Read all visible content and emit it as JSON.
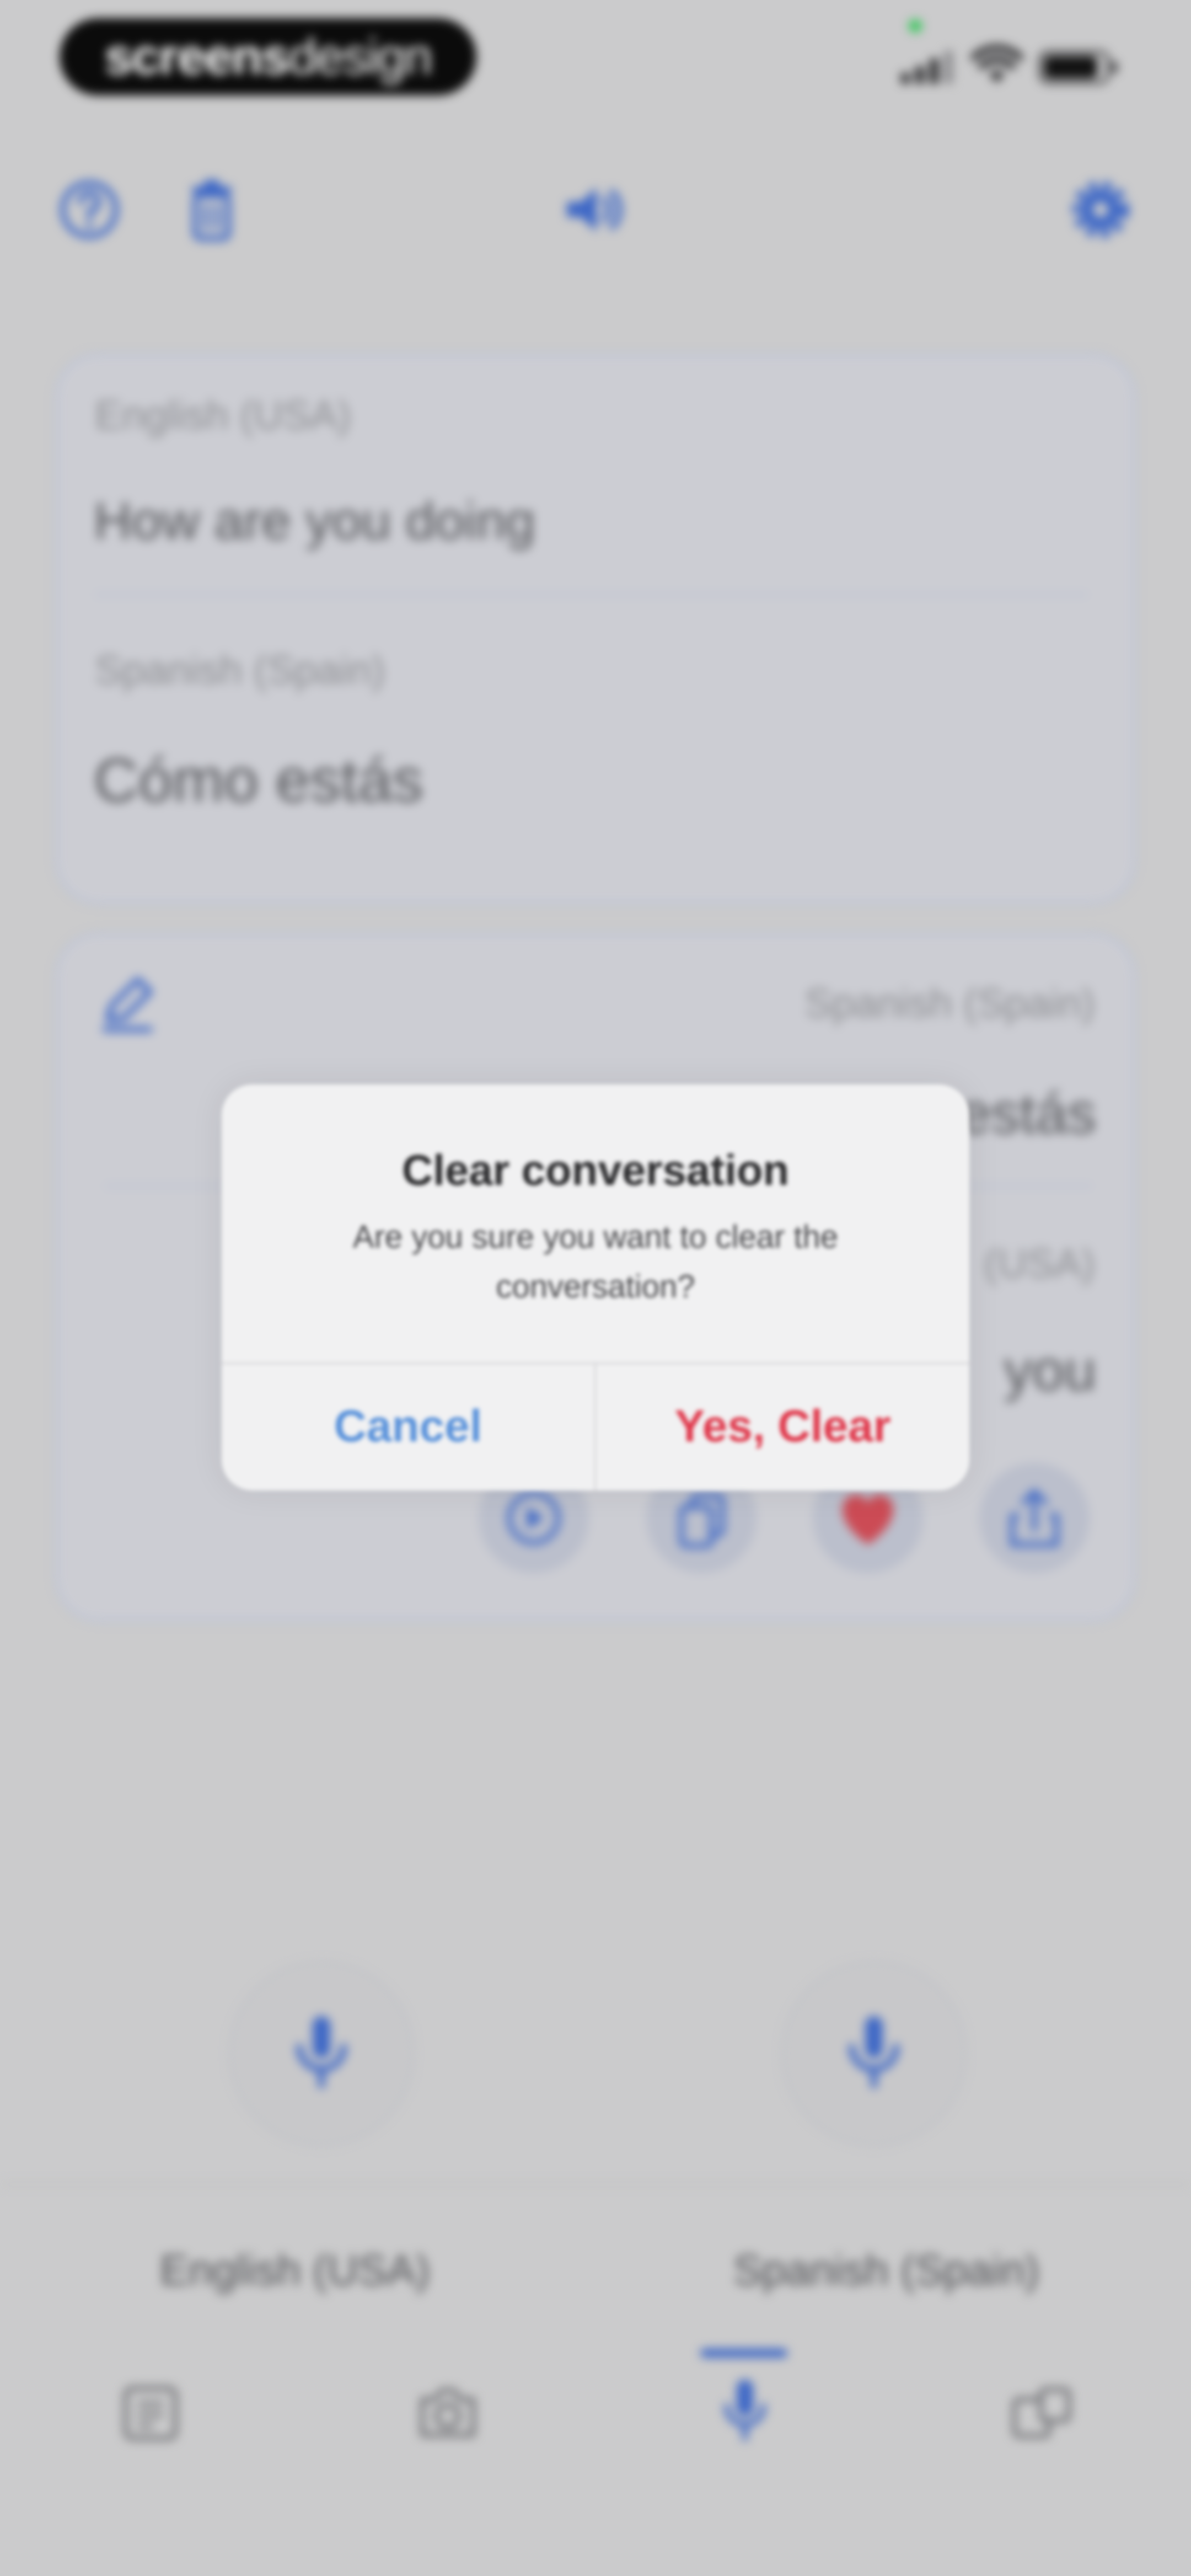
{
  "status_bar": {
    "brand_bold": "screens",
    "brand_light": "design"
  },
  "toolbar": {
    "help_icon": "question-circle-icon",
    "delete_icon": "trash-icon",
    "speaker_icon": "speaker-icon",
    "settings_icon": "gear-icon"
  },
  "card1": {
    "source_lang": "English (USA)",
    "source_text": "How are you doing",
    "target_lang": "Spanish (Spain)",
    "target_text": "Cómo estás"
  },
  "card2": {
    "source_lang": "Spanish (Spain)",
    "source_text_visible": "estás",
    "target_lang_visible": "(USA)",
    "target_text_visible": "you"
  },
  "dialog": {
    "title": "Clear conversation",
    "message": "Are you sure you want to clear the conversation?",
    "cancel": "Cancel",
    "confirm": "Yes, Clear"
  },
  "bottom": {
    "left_lang": "English (USA)",
    "right_lang": "Spanish (Spain)"
  },
  "colors": {
    "accent": "#3d67c6",
    "destructive": "#e03a4d",
    "link": "#5b93db"
  }
}
